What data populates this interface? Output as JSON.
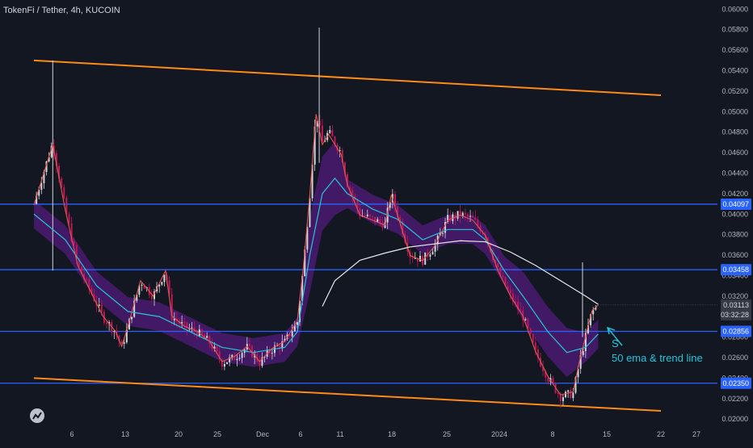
{
  "window": {
    "title": "TokenFi / Tether, 4h, KUCOIN"
  },
  "colors": {
    "background": "#131722",
    "candle_up": "#d1d4dc",
    "candle_down": "#c2185b",
    "ema_fast": "#e05a4f",
    "ema_cyan": "#26c6da",
    "cloud": "#6a1b9a",
    "sma_white": "#e8e8e8",
    "channel": "#ff8a1a",
    "level_line": "#2962ff",
    "annotation": "#26c6da"
  },
  "chart_data": {
    "type": "candlestick",
    "title": "TokenFi / Tether, 4h, KUCOIN",
    "xlabel": "",
    "ylabel": "",
    "x_ticks": [
      "6",
      "13",
      "20",
      "25",
      "Dec",
      "6",
      "11",
      "18",
      "25",
      "2024",
      "8",
      "15",
      "22",
      "27"
    ],
    "y_ticks": [
      "0.06000",
      "0.05800",
      "0.05600",
      "0.05400",
      "0.05200",
      "0.05000",
      "0.04800",
      "0.04600",
      "0.04400",
      "0.04200",
      "0.04000",
      "0.03800",
      "0.03600",
      "0.03400",
      "0.03200",
      "0.03000",
      "0.02800",
      "0.02600",
      "0.02400",
      "0.02200",
      "0.02000"
    ],
    "ylim": [
      0.0197,
      0.0605
    ],
    "price_scale": "right",
    "horizontal_levels": [
      {
        "value": 0.04097,
        "label": "0.04097"
      },
      {
        "value": 0.03458,
        "label": "0.03458"
      },
      {
        "value": 0.02856,
        "label": "0.02856"
      },
      {
        "value": 0.0235,
        "label": "0.02350"
      }
    ],
    "current_price": {
      "value": 0.03113,
      "label": "0.03113",
      "countdown": "03:32:28"
    },
    "channel_lines": [
      {
        "points": [
          [
            0,
            0.055
          ],
          [
            100,
            0.0516
          ]
        ]
      },
      {
        "points": [
          [
            0,
            0.024
          ],
          [
            100,
            0.0208
          ]
        ]
      }
    ],
    "annotation": {
      "lines": [
        "S",
        "50 ema & trend line"
      ]
    },
    "price_path": [
      [
        0,
        0.041
      ],
      [
        3,
        0.047
      ],
      [
        5,
        0.0405
      ],
      [
        7,
        0.035
      ],
      [
        9,
        0.0325
      ],
      [
        11,
        0.03
      ],
      [
        13,
        0.0285
      ],
      [
        14,
        0.027
      ],
      [
        15,
        0.029
      ],
      [
        17,
        0.0335
      ],
      [
        19,
        0.032
      ],
      [
        21,
        0.0345
      ],
      [
        22,
        0.03
      ],
      [
        24,
        0.029
      ],
      [
        26,
        0.0285
      ],
      [
        28,
        0.0275
      ],
      [
        30,
        0.0255
      ],
      [
        32,
        0.026
      ],
      [
        34,
        0.027
      ],
      [
        36,
        0.0255
      ],
      [
        38,
        0.0268
      ],
      [
        40,
        0.0275
      ],
      [
        42,
        0.0295
      ],
      [
        43,
        0.035
      ],
      [
        44,
        0.042
      ],
      [
        45,
        0.05
      ],
      [
        46,
        0.047
      ],
      [
        47,
        0.048
      ],
      [
        49,
        0.046
      ],
      [
        50,
        0.043
      ],
      [
        52,
        0.04
      ],
      [
        54,
        0.0395
      ],
      [
        56,
        0.039
      ],
      [
        57,
        0.042
      ],
      [
        58,
        0.04
      ],
      [
        60,
        0.036
      ],
      [
        62,
        0.0355
      ],
      [
        64,
        0.037
      ],
      [
        66,
        0.0395
      ],
      [
        68,
        0.04
      ],
      [
        70,
        0.0395
      ],
      [
        72,
        0.038
      ],
      [
        74,
        0.0345
      ],
      [
        76,
        0.032
      ],
      [
        78,
        0.03
      ],
      [
        80,
        0.0265
      ],
      [
        82,
        0.024
      ],
      [
        84,
        0.0222
      ],
      [
        86,
        0.0225
      ],
      [
        87,
        0.0255
      ],
      [
        88,
        0.028
      ],
      [
        89,
        0.0305
      ],
      [
        90,
        0.0311
      ]
    ],
    "ema_path": [
      [
        0,
        0.04
      ],
      [
        5,
        0.0375
      ],
      [
        10,
        0.033
      ],
      [
        15,
        0.0305
      ],
      [
        20,
        0.03
      ],
      [
        25,
        0.0285
      ],
      [
        30,
        0.027
      ],
      [
        35,
        0.0265
      ],
      [
        40,
        0.027
      ],
      [
        42,
        0.0285
      ],
      [
        44,
        0.036
      ],
      [
        46,
        0.042
      ],
      [
        48,
        0.0435
      ],
      [
        50,
        0.042
      ],
      [
        54,
        0.0405
      ],
      [
        58,
        0.0395
      ],
      [
        62,
        0.0375
      ],
      [
        66,
        0.0385
      ],
      [
        70,
        0.0385
      ],
      [
        72,
        0.0375
      ],
      [
        75,
        0.0345
      ],
      [
        78,
        0.032
      ],
      [
        82,
        0.0285
      ],
      [
        85,
        0.0265
      ],
      [
        88,
        0.027
      ],
      [
        90,
        0.0283
      ]
    ],
    "sma_path": [
      [
        46,
        0.031
      ],
      [
        48,
        0.0335
      ],
      [
        52,
        0.0355
      ],
      [
        56,
        0.0362
      ],
      [
        60,
        0.0368
      ],
      [
        64,
        0.0371
      ],
      [
        68,
        0.0374
      ],
      [
        72,
        0.0373
      ],
      [
        76,
        0.0363
      ],
      [
        80,
        0.035
      ],
      [
        84,
        0.0335
      ],
      [
        88,
        0.032
      ],
      [
        90,
        0.0312
      ]
    ],
    "labels": {
      "legend": "",
      "countdown": "03:32:28"
    }
  }
}
